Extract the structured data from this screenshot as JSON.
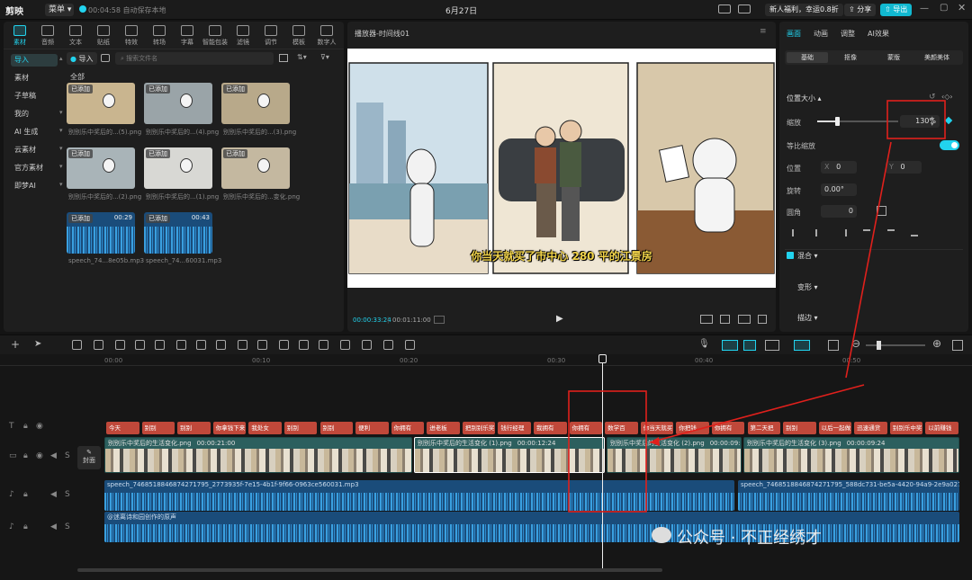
{
  "app": {
    "name": "剪映",
    "menu": "菜单",
    "autosave": "00:04:58 自动保存本地",
    "date": "6月27日"
  },
  "topright": {
    "promo": "新人福利，幸运0.8折",
    "share": "分享",
    "export": "导出"
  },
  "left": {
    "tabs": [
      "素材",
      "音频",
      "文本",
      "贴纸",
      "特效",
      "转场",
      "字幕",
      "智能包装",
      "滤镜",
      "调节",
      "模板",
      "数字人"
    ],
    "side": [
      "导入",
      "素材",
      "子草稿",
      "我的",
      "AI 生成",
      "云素材",
      "官方素材",
      "即梦AI"
    ],
    "import_btn": "导入",
    "search_placeholder": "搜索文件名",
    "all_label": "全部",
    "added": "已添加",
    "files": [
      "别别乐中奖后的...(5).png",
      "别别乐中奖后的...(4).png",
      "别别乐中奖后的...(3).png",
      "别别乐中奖后的...(2).png",
      "别别乐中奖后的...(1).png",
      "别别乐中奖后的...变化.png",
      "speech_74...8e05b.mp3",
      "speech_74...60031.mp3"
    ],
    "audio_durations": [
      "00:29",
      "00:43"
    ]
  },
  "preview": {
    "title": "播放器-时间线01",
    "subtitle": "你当天就买了市中心 280 平的江景房",
    "current": "00:00:33:24",
    "total": "00:01:11:00"
  },
  "right": {
    "tabs": [
      "画面",
      "动画",
      "调整",
      "AI效果"
    ],
    "subtabs": [
      "基础",
      "抠像",
      "蒙版",
      "美颜美体"
    ],
    "position_size": "位置大小",
    "scale_label": "缩放",
    "scale_value": "130%",
    "uniform": "等比缩放",
    "pos_label": "位置",
    "x_label": "X",
    "x_value": "0",
    "y_label": "Y",
    "y_value": "0",
    "rotate_label": "旋转",
    "rotate_value": "0.00°",
    "corner_label": "圆角",
    "corner_value": "0",
    "blend": "混合",
    "transform": "变形",
    "stroke": "描边"
  },
  "timeline": {
    "ruler": [
      "00:00",
      "00:10",
      "00:20",
      "00:30",
      "00:40",
      "00:50"
    ],
    "cover": "封面",
    "captions": [
      "今天",
      "别别",
      "别别",
      "你拿钱下来",
      "我处女",
      "别别",
      "别别",
      "便利",
      "你拥有",
      "进老板",
      "把别别乐奖",
      "钱行经理",
      "我拥有",
      "你拥有",
      "数学百",
      "你当天就买",
      "你把钱",
      "你拥有",
      "第二天把",
      "别别",
      "以后一起做",
      "迅速通货",
      "别别乐中奖",
      "以前赚钱"
    ],
    "vclips": [
      {
        "name": "别别乐中奖后的生活变化.png",
        "time": "00:00:21:00"
      },
      {
        "name": "别别乐中奖后的生活变化 (1).png",
        "time": "00:00:12:24"
      },
      {
        "name": "别别乐中奖后的生活变化 (2).png",
        "time": "00:00:09:08"
      },
      {
        "name": "别别乐中奖后的生活变化 (3).png",
        "time": "00:00:09:24"
      }
    ],
    "audio1a": "speech_7468518846874271795_2773935f-7e15-4b1f-9f66-0963ce560031.mp3",
    "audio1b": "speech_7468518846874271795_588dc731-be5a-4420-94a9-2e9a0278e05b.mp3",
    "audio2": "@迷离诗和园创作的原声",
    "watermark": "公众号 · 不正经绣才"
  },
  "colors": {
    "accent": "#22d3ee",
    "caption": "#c0483a",
    "video": "#2c5f5e",
    "audio": "#1a4c7a",
    "annotation": "#e0201c"
  }
}
